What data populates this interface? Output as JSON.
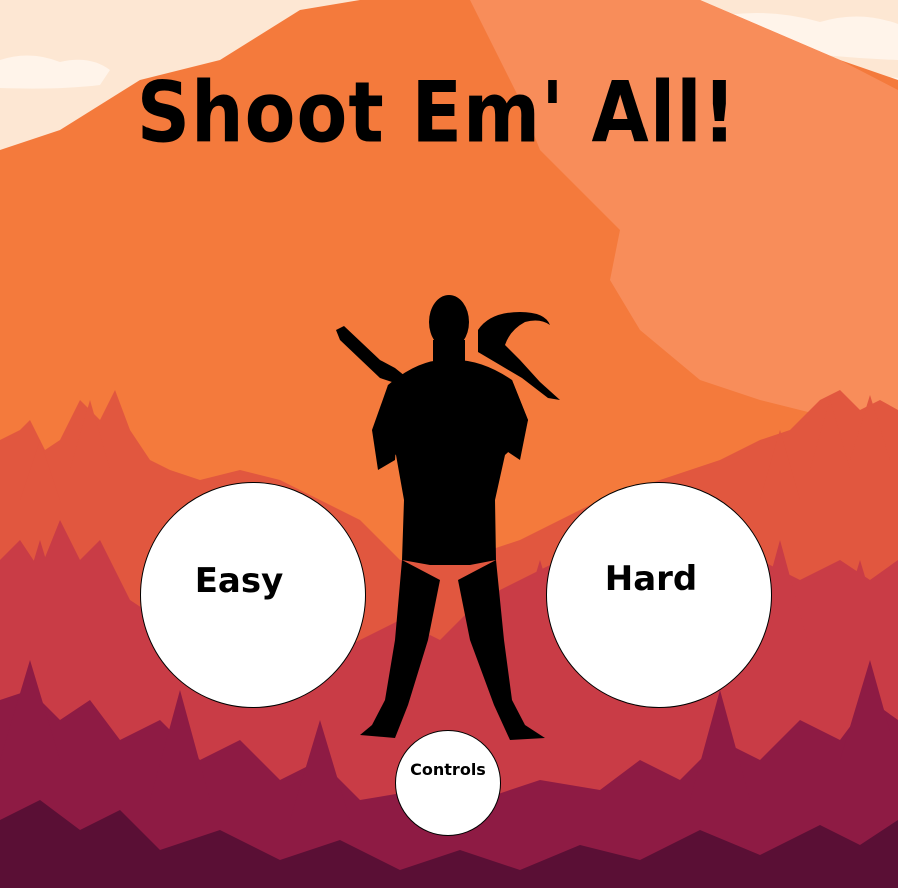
{
  "title": "Shoot Em' All!",
  "buttons": {
    "easy": "Easy",
    "hard": "Hard",
    "controls": "Controls"
  },
  "colors": {
    "sky": "#fde7d3",
    "mountain_main": "#f47a3c",
    "mountain_light": "#f88d5a",
    "trees_far": "#e1573f",
    "trees_mid": "#c93c46",
    "trees_near": "#8e1b44",
    "silhouette": "#000000",
    "button_fill": "#ffffff"
  },
  "icons": {
    "background": "forest-mountain-landscape",
    "character": "soldier-with-rifle-and-bird-silhouette"
  }
}
